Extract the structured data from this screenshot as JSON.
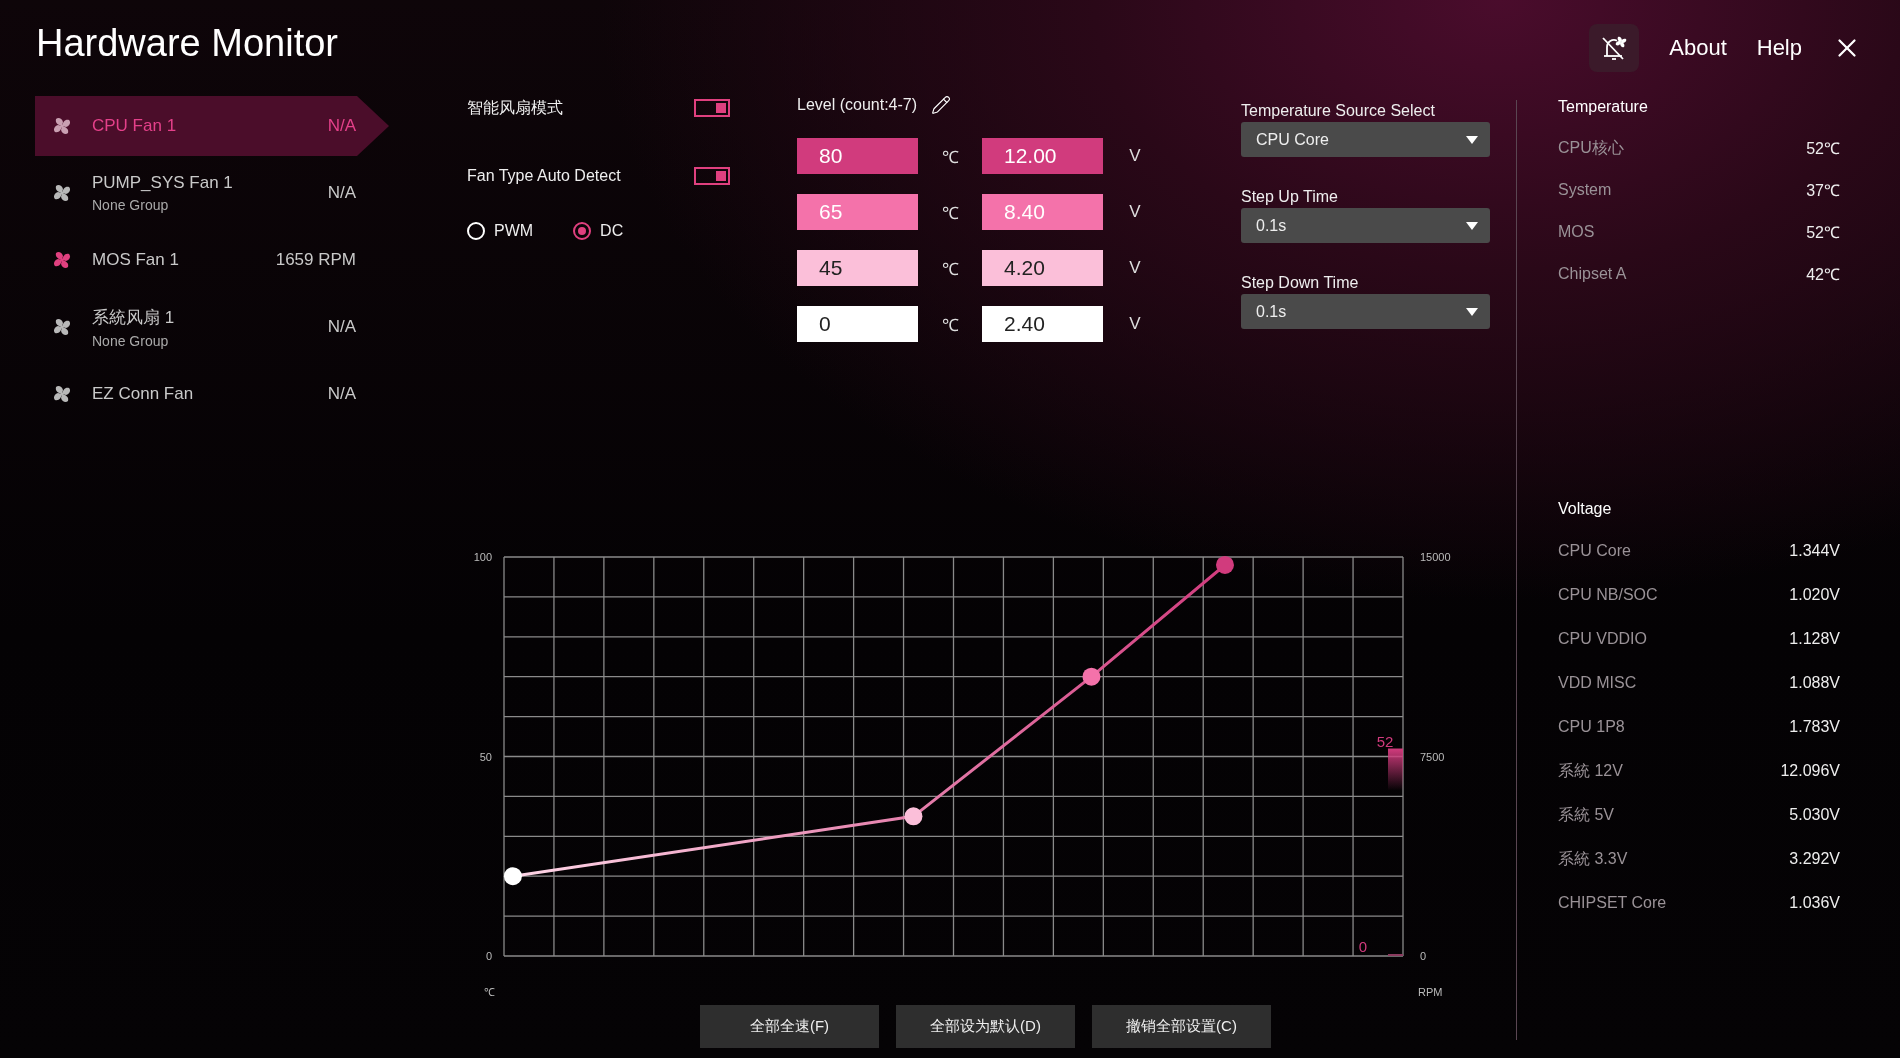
{
  "title": "Hardware Monitor",
  "top_links": [
    "About",
    "Help"
  ],
  "fans": [
    {
      "name": "CPU Fan 1",
      "reading": "N/A",
      "selected": true,
      "running": false
    },
    {
      "name": "PUMP_SYS Fan 1",
      "group": "None Group",
      "reading": "N/A",
      "selected": false,
      "running": false
    },
    {
      "name": "MOS Fan 1",
      "reading": "1659 RPM",
      "selected": false,
      "running": true
    },
    {
      "name": "系統风扇 1",
      "group": "None Group",
      "reading": "N/A",
      "selected": false,
      "running": false
    },
    {
      "name": "EZ Conn Fan",
      "reading": "N/A",
      "selected": false,
      "running": false
    }
  ],
  "toggles": [
    {
      "label": "智能风扇模式",
      "on": true
    },
    {
      "label": "Fan Type Auto Detect",
      "on": true
    }
  ],
  "fan_type": [
    {
      "label": "PWM",
      "selected": false
    },
    {
      "label": "DC",
      "selected": true
    }
  ],
  "levels": {
    "header": "Level (count:4-7)",
    "rows": [
      {
        "temperature": "80",
        "temp_unit": "℃",
        "voltage": "12.00",
        "volt_unit": "V",
        "color": "#d13b7d"
      },
      {
        "temperature": "65",
        "temp_unit": "℃",
        "voltage": "8.40",
        "volt_unit": "V",
        "color": "#f472aa"
      },
      {
        "temperature": "45",
        "temp_unit": "℃",
        "voltage": "4.20",
        "volt_unit": "V",
        "color": "#fbbfd9"
      },
      {
        "temperature": "0",
        "temp_unit": "℃",
        "voltage": "2.40",
        "volt_unit": "V",
        "color": "#ffffff"
      }
    ]
  },
  "settings": [
    {
      "label": "Temperature Source Select",
      "value": "CPU Core"
    },
    {
      "label": "Step Up Time",
      "value": "0.1s"
    },
    {
      "label": "Step Down Time",
      "value": "0.1s"
    }
  ],
  "temperature": {
    "heading": "Temperature",
    "rows": [
      {
        "name": "CPU核心",
        "value": "52℃"
      },
      {
        "name": "System",
        "value": "37℃"
      },
      {
        "name": "MOS",
        "value": "52℃"
      },
      {
        "name": "Chipset A",
        "value": "42℃"
      }
    ]
  },
  "voltage": {
    "heading": "Voltage",
    "rows": [
      {
        "name": "CPU Core",
        "value": "1.344V"
      },
      {
        "name": "CPU NB/SOC",
        "value": "1.020V"
      },
      {
        "name": "CPU VDDIO",
        "value": "1.128V"
      },
      {
        "name": "VDD MISC",
        "value": "1.088V"
      },
      {
        "name": "CPU 1P8",
        "value": "1.783V"
      },
      {
        "name": "系統 12V",
        "value": "12.096V"
      },
      {
        "name": "系統 5V",
        "value": "5.030V"
      },
      {
        "name": "系統 3.3V",
        "value": "3.292V"
      },
      {
        "name": "CHIPSET Core",
        "value": "1.036V"
      }
    ]
  },
  "chart": {
    "left_unit": "℃",
    "right_unit": "RPM",
    "left_ticks": [
      "100",
      "50",
      "0"
    ],
    "rpm_ticks": [
      "15000",
      "7500",
      "0"
    ],
    "temperature_reading": "52",
    "rpm_reading": "0"
  },
  "buttons": [
    "全部全速(F)",
    "全部设为默认(D)",
    "撤销全部设置(C)"
  ]
}
